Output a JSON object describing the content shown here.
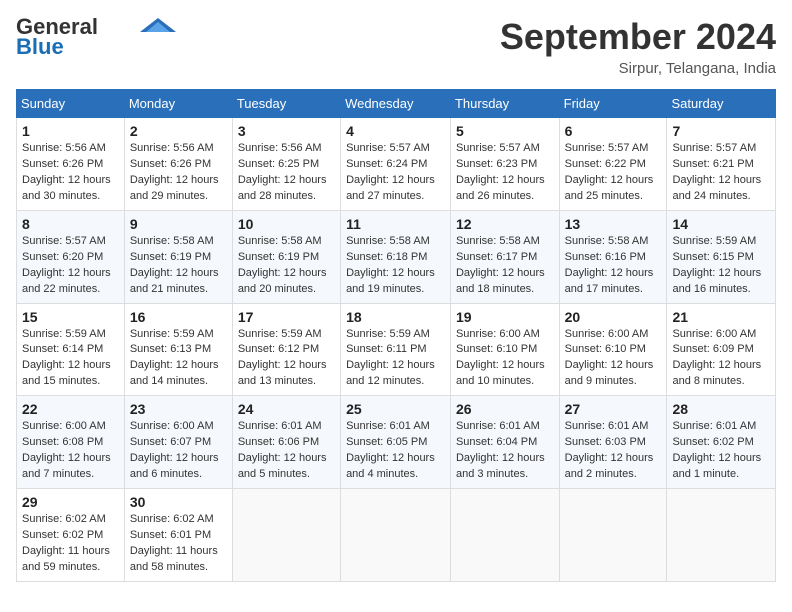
{
  "header": {
    "logo_general": "General",
    "logo_blue": "Blue",
    "month_title": "September 2024",
    "location": "Sirpur, Telangana, India"
  },
  "days_of_week": [
    "Sunday",
    "Monday",
    "Tuesday",
    "Wednesday",
    "Thursday",
    "Friday",
    "Saturday"
  ],
  "weeks": [
    [
      {
        "day": "1",
        "sunrise": "Sunrise: 5:56 AM",
        "sunset": "Sunset: 6:26 PM",
        "daylight": "Daylight: 12 hours and 30 minutes."
      },
      {
        "day": "2",
        "sunrise": "Sunrise: 5:56 AM",
        "sunset": "Sunset: 6:26 PM",
        "daylight": "Daylight: 12 hours and 29 minutes."
      },
      {
        "day": "3",
        "sunrise": "Sunrise: 5:56 AM",
        "sunset": "Sunset: 6:25 PM",
        "daylight": "Daylight: 12 hours and 28 minutes."
      },
      {
        "day": "4",
        "sunrise": "Sunrise: 5:57 AM",
        "sunset": "Sunset: 6:24 PM",
        "daylight": "Daylight: 12 hours and 27 minutes."
      },
      {
        "day": "5",
        "sunrise": "Sunrise: 5:57 AM",
        "sunset": "Sunset: 6:23 PM",
        "daylight": "Daylight: 12 hours and 26 minutes."
      },
      {
        "day": "6",
        "sunrise": "Sunrise: 5:57 AM",
        "sunset": "Sunset: 6:22 PM",
        "daylight": "Daylight: 12 hours and 25 minutes."
      },
      {
        "day": "7",
        "sunrise": "Sunrise: 5:57 AM",
        "sunset": "Sunset: 6:21 PM",
        "daylight": "Daylight: 12 hours and 24 minutes."
      }
    ],
    [
      {
        "day": "8",
        "sunrise": "Sunrise: 5:57 AM",
        "sunset": "Sunset: 6:20 PM",
        "daylight": "Daylight: 12 hours and 22 minutes."
      },
      {
        "day": "9",
        "sunrise": "Sunrise: 5:58 AM",
        "sunset": "Sunset: 6:19 PM",
        "daylight": "Daylight: 12 hours and 21 minutes."
      },
      {
        "day": "10",
        "sunrise": "Sunrise: 5:58 AM",
        "sunset": "Sunset: 6:19 PM",
        "daylight": "Daylight: 12 hours and 20 minutes."
      },
      {
        "day": "11",
        "sunrise": "Sunrise: 5:58 AM",
        "sunset": "Sunset: 6:18 PM",
        "daylight": "Daylight: 12 hours and 19 minutes."
      },
      {
        "day": "12",
        "sunrise": "Sunrise: 5:58 AM",
        "sunset": "Sunset: 6:17 PM",
        "daylight": "Daylight: 12 hours and 18 minutes."
      },
      {
        "day": "13",
        "sunrise": "Sunrise: 5:58 AM",
        "sunset": "Sunset: 6:16 PM",
        "daylight": "Daylight: 12 hours and 17 minutes."
      },
      {
        "day": "14",
        "sunrise": "Sunrise: 5:59 AM",
        "sunset": "Sunset: 6:15 PM",
        "daylight": "Daylight: 12 hours and 16 minutes."
      }
    ],
    [
      {
        "day": "15",
        "sunrise": "Sunrise: 5:59 AM",
        "sunset": "Sunset: 6:14 PM",
        "daylight": "Daylight: 12 hours and 15 minutes."
      },
      {
        "day": "16",
        "sunrise": "Sunrise: 5:59 AM",
        "sunset": "Sunset: 6:13 PM",
        "daylight": "Daylight: 12 hours and 14 minutes."
      },
      {
        "day": "17",
        "sunrise": "Sunrise: 5:59 AM",
        "sunset": "Sunset: 6:12 PM",
        "daylight": "Daylight: 12 hours and 13 minutes."
      },
      {
        "day": "18",
        "sunrise": "Sunrise: 5:59 AM",
        "sunset": "Sunset: 6:11 PM",
        "daylight": "Daylight: 12 hours and 12 minutes."
      },
      {
        "day": "19",
        "sunrise": "Sunrise: 6:00 AM",
        "sunset": "Sunset: 6:10 PM",
        "daylight": "Daylight: 12 hours and 10 minutes."
      },
      {
        "day": "20",
        "sunrise": "Sunrise: 6:00 AM",
        "sunset": "Sunset: 6:10 PM",
        "daylight": "Daylight: 12 hours and 9 minutes."
      },
      {
        "day": "21",
        "sunrise": "Sunrise: 6:00 AM",
        "sunset": "Sunset: 6:09 PM",
        "daylight": "Daylight: 12 hours and 8 minutes."
      }
    ],
    [
      {
        "day": "22",
        "sunrise": "Sunrise: 6:00 AM",
        "sunset": "Sunset: 6:08 PM",
        "daylight": "Daylight: 12 hours and 7 minutes."
      },
      {
        "day": "23",
        "sunrise": "Sunrise: 6:00 AM",
        "sunset": "Sunset: 6:07 PM",
        "daylight": "Daylight: 12 hours and 6 minutes."
      },
      {
        "day": "24",
        "sunrise": "Sunrise: 6:01 AM",
        "sunset": "Sunset: 6:06 PM",
        "daylight": "Daylight: 12 hours and 5 minutes."
      },
      {
        "day": "25",
        "sunrise": "Sunrise: 6:01 AM",
        "sunset": "Sunset: 6:05 PM",
        "daylight": "Daylight: 12 hours and 4 minutes."
      },
      {
        "day": "26",
        "sunrise": "Sunrise: 6:01 AM",
        "sunset": "Sunset: 6:04 PM",
        "daylight": "Daylight: 12 hours and 3 minutes."
      },
      {
        "day": "27",
        "sunrise": "Sunrise: 6:01 AM",
        "sunset": "Sunset: 6:03 PM",
        "daylight": "Daylight: 12 hours and 2 minutes."
      },
      {
        "day": "28",
        "sunrise": "Sunrise: 6:01 AM",
        "sunset": "Sunset: 6:02 PM",
        "daylight": "Daylight: 12 hours and 1 minute."
      }
    ],
    [
      {
        "day": "29",
        "sunrise": "Sunrise: 6:02 AM",
        "sunset": "Sunset: 6:02 PM",
        "daylight": "Daylight: 11 hours and 59 minutes."
      },
      {
        "day": "30",
        "sunrise": "Sunrise: 6:02 AM",
        "sunset": "Sunset: 6:01 PM",
        "daylight": "Daylight: 11 hours and 58 minutes."
      },
      null,
      null,
      null,
      null,
      null
    ]
  ]
}
